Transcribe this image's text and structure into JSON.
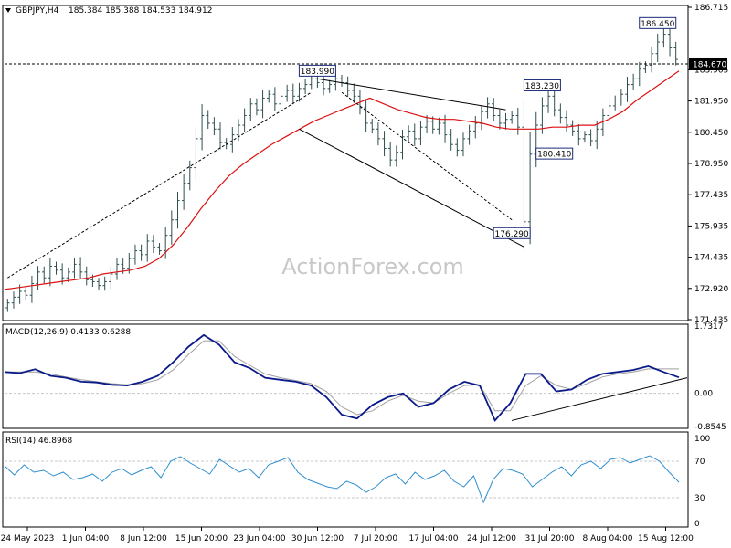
{
  "header": {
    "symbol": "GBPJPY,H4",
    "ohlc": "185.384 185.388 184.533 184.912"
  },
  "watermark": "ActionForex.com",
  "colors": {
    "price": "#2f4f4f",
    "ma": "#dd1111",
    "macd": "#0a1a8a",
    "signal": "#a0a0a0",
    "rsi": "#2f8fd0",
    "trend": "#000000",
    "grid": "#c8c8c8"
  },
  "chart_data": [
    {
      "type": "candlestick",
      "panel": "price",
      "ylim": [
        171.435,
        187.6
      ],
      "y_ticks": [
        "186.715",
        "184.670",
        "183.965",
        "181.950",
        "180.450",
        "178.950",
        "177.435",
        "175.935",
        "174.435",
        "172.920",
        "171.435"
      ],
      "current_price_label": "184.670",
      "current_price_value": 184.67,
      "closes": [
        172.3,
        172.6,
        172.9,
        172.7,
        173.3,
        173.9,
        173.6,
        174.2,
        174.0,
        173.6,
        173.9,
        174.3,
        173.9,
        173.5,
        173.4,
        173.2,
        173.4,
        173.8,
        174.3,
        174.1,
        174.6,
        175.0,
        174.8,
        175.5,
        175.2,
        175.0,
        175.8,
        176.6,
        177.6,
        178.5,
        179.3,
        180.8,
        182.0,
        181.6,
        181.3,
        180.6,
        180.5,
        181.0,
        181.5,
        182.0,
        182.6,
        182.3,
        182.9,
        183.1,
        182.6,
        183.0,
        183.3,
        183.0,
        183.4,
        183.6,
        183.9,
        183.7,
        183.4,
        183.6,
        183.9,
        183.7,
        183.3,
        183.0,
        182.4,
        181.6,
        181.3,
        180.8,
        180.3,
        179.7,
        180.1,
        180.9,
        181.2,
        180.8,
        181.4,
        181.7,
        181.3,
        181.6,
        181.0,
        180.5,
        180.2,
        180.8,
        181.2,
        181.6,
        182.2,
        182.6,
        182.0,
        181.6,
        181.8,
        182.0,
        181.4,
        176.5,
        180.0,
        181.5,
        182.5,
        183.0,
        182.3,
        181.9,
        181.5,
        181.2,
        180.8,
        181.0,
        180.7,
        181.3,
        182.0,
        182.5,
        182.8,
        183.1,
        183.6,
        183.9,
        184.4,
        184.6,
        185.2,
        185.8,
        186.2,
        185.5,
        184.9
      ],
      "ma_values": [
        173.0,
        173.1,
        173.2,
        173.3,
        173.4,
        173.5,
        173.6,
        173.8,
        173.9,
        174.0,
        174.2,
        174.6,
        175.3,
        176.2,
        177.2,
        178.1,
        178.9,
        179.5,
        180.0,
        180.5,
        180.9,
        181.3,
        181.7,
        182.0,
        182.3,
        182.6,
        182.9,
        182.6,
        182.3,
        182.1,
        181.9,
        181.8,
        181.8,
        181.7,
        181.6,
        181.4,
        181.3,
        181.3,
        181.3,
        181.4,
        181.4,
        181.5,
        181.5,
        181.8,
        182.2,
        182.8,
        183.3,
        183.8,
        184.3
      ],
      "annotations": [
        {
          "label": "183.990",
          "value": 183.99
        },
        {
          "label": "176.290",
          "value": 176.29
        },
        {
          "label": "183.230",
          "value": 183.23
        },
        {
          "label": "180.410",
          "value": 180.41
        },
        {
          "label": "186.450",
          "value": 186.45
        }
      ],
      "x_ticks": [
        "24 May 2023",
        "1 Jun 04:00",
        "8 Jun 12:00",
        "15 Jun 20:00",
        "23 Jun 04:00",
        "30 Jun 12:00",
        "7 Jul 20:00",
        "17 Jul 04:00",
        "24 Jul 12:00",
        "31 Jul 20:00",
        "8 Aug 04:00",
        "15 Aug 12:00"
      ]
    },
    {
      "type": "line",
      "panel": "macd",
      "label": "MACD(12,26,9) 0.4133 0.6288",
      "ylim": [
        -0.8545,
        1.7317
      ],
      "y_ticks": [
        "1.7317",
        "0.00",
        "-0.8545"
      ],
      "macd": [
        0.55,
        0.52,
        0.62,
        0.45,
        0.4,
        0.3,
        0.28,
        0.22,
        0.2,
        0.3,
        0.45,
        0.8,
        1.2,
        1.5,
        1.25,
        0.8,
        0.65,
        0.4,
        0.35,
        0.3,
        0.2,
        -0.1,
        -0.55,
        -0.65,
        -0.3,
        -0.1,
        0.0,
        -0.35,
        -0.25,
        0.1,
        0.3,
        0.2,
        -0.7,
        -0.25,
        0.5,
        0.5,
        0.05,
        0.1,
        0.35,
        0.5,
        0.55,
        0.6,
        0.7,
        0.55,
        0.41
      ],
      "signal": [
        0.55,
        0.55,
        0.55,
        0.5,
        0.42,
        0.35,
        0.3,
        0.25,
        0.22,
        0.25,
        0.35,
        0.6,
        1.0,
        1.35,
        1.35,
        0.95,
        0.72,
        0.5,
        0.4,
        0.33,
        0.25,
        0.05,
        -0.35,
        -0.55,
        -0.45,
        -0.2,
        -0.05,
        -0.2,
        -0.25,
        0.0,
        0.2,
        0.22,
        -0.45,
        -0.45,
        0.2,
        0.45,
        0.2,
        0.1,
        0.25,
        0.42,
        0.5,
        0.55,
        0.63,
        0.63,
        0.63
      ]
    },
    {
      "type": "line",
      "panel": "rsi",
      "label": "RSI(14) 46.8968",
      "ylim": [
        0,
        100
      ],
      "y_ticks": [
        "100",
        "70",
        "30",
        "0"
      ],
      "levels": [
        70,
        30
      ],
      "values": [
        65,
        55,
        66,
        58,
        60,
        54,
        58,
        50,
        52,
        56,
        48,
        58,
        62,
        55,
        60,
        64,
        52,
        70,
        75,
        68,
        62,
        56,
        72,
        65,
        58,
        62,
        52,
        66,
        70,
        74,
        58,
        50,
        46,
        42,
        40,
        48,
        44,
        36,
        42,
        52,
        56,
        45,
        58,
        50,
        54,
        60,
        48,
        42,
        54,
        25,
        50,
        62,
        60,
        56,
        42,
        50,
        58,
        64,
        54,
        66,
        70,
        62,
        72,
        74,
        68,
        72,
        76,
        70,
        58,
        47
      ]
    }
  ]
}
